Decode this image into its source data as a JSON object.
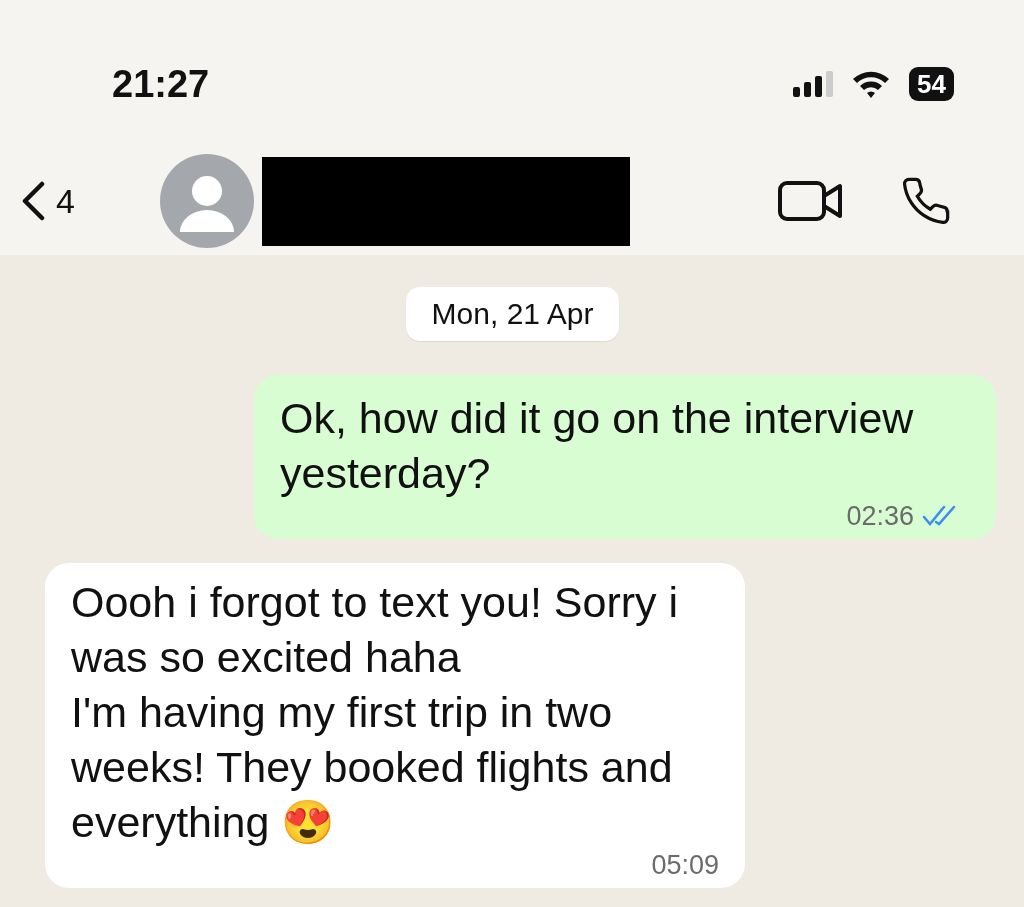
{
  "status_bar": {
    "time": "21:27",
    "battery": "54"
  },
  "header": {
    "back_count": "4"
  },
  "date_chip": "Mon, 21 Apr",
  "messages": [
    {
      "kind": "outgoing",
      "text": "Ok, how did it go on the interview yesterday?",
      "time": "02:36",
      "read": true
    },
    {
      "kind": "incoming",
      "text": "Oooh i forgot to text you! Sorry i was so excited haha\nI'm having my first trip in two weeks! They booked flights and everything 😍",
      "time": "05:09"
    }
  ]
}
